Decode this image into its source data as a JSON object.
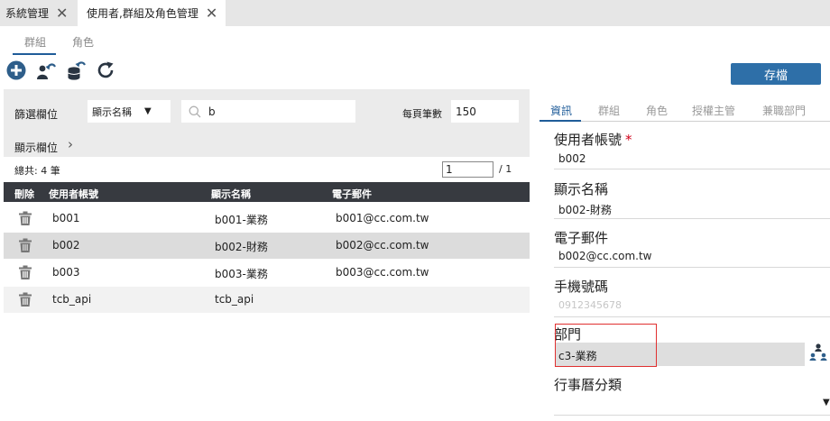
{
  "tabs": [
    {
      "label": "系統管理",
      "close": "✕"
    },
    {
      "label": "使用者,群組及角色管理",
      "close": "✕"
    }
  ],
  "subtabs": [
    "群組",
    "角色"
  ],
  "toolbar": {
    "save_label": "存檔",
    "icons": [
      "add-circle-icon",
      "user-undo-icon",
      "database-undo-icon",
      "refresh-icon"
    ]
  },
  "filter": {
    "field_label": "篩選欄位",
    "field_value": "顯示名稱",
    "caret": "▼",
    "search_value": "b",
    "page_size_label": "每頁筆數",
    "page_size_value": "150",
    "columns_label": "顯示欄位",
    "columns_chevron": "›"
  },
  "summary": {
    "total": "總共: 4 筆",
    "page": "1",
    "page_total": "/  1"
  },
  "table": {
    "headers": [
      "刪除",
      "使用者帳號",
      "顯示名稱",
      "電子郵件"
    ],
    "rows": [
      {
        "account": "b001",
        "name": "b001-業務",
        "email": "b001@cc.com.tw"
      },
      {
        "account": "b002",
        "name": "b002-財務",
        "email": "b002@cc.com.tw"
      },
      {
        "account": "b003",
        "name": "b003-業務",
        "email": "b003@cc.com.tw"
      },
      {
        "account": "tcb_api",
        "name": "tcb_api",
        "email": ""
      }
    ]
  },
  "detail": {
    "tabs": [
      "資訊",
      "群組",
      "角色",
      "授權主管",
      "兼職部門"
    ],
    "account_label": "使用者帳號",
    "required_mark": "*",
    "account_value": "b002",
    "name_label": "顯示名稱",
    "name_value": "b002-財務",
    "email_label": "電子郵件",
    "email_value": "b002@cc.com.tw",
    "phone_label": "手機號碼",
    "phone_placeholder": "0912345678",
    "dept_label": "部門",
    "dept_value": "c3-業務",
    "calendar_label": "行事曆分類",
    "calendar_caret": "▼"
  },
  "colors": {
    "accent": "#1f5c99",
    "save_button": "#2e6fa8",
    "table_header": "#373a40",
    "highlight_border": "#e03030",
    "required": "#d0021b"
  }
}
